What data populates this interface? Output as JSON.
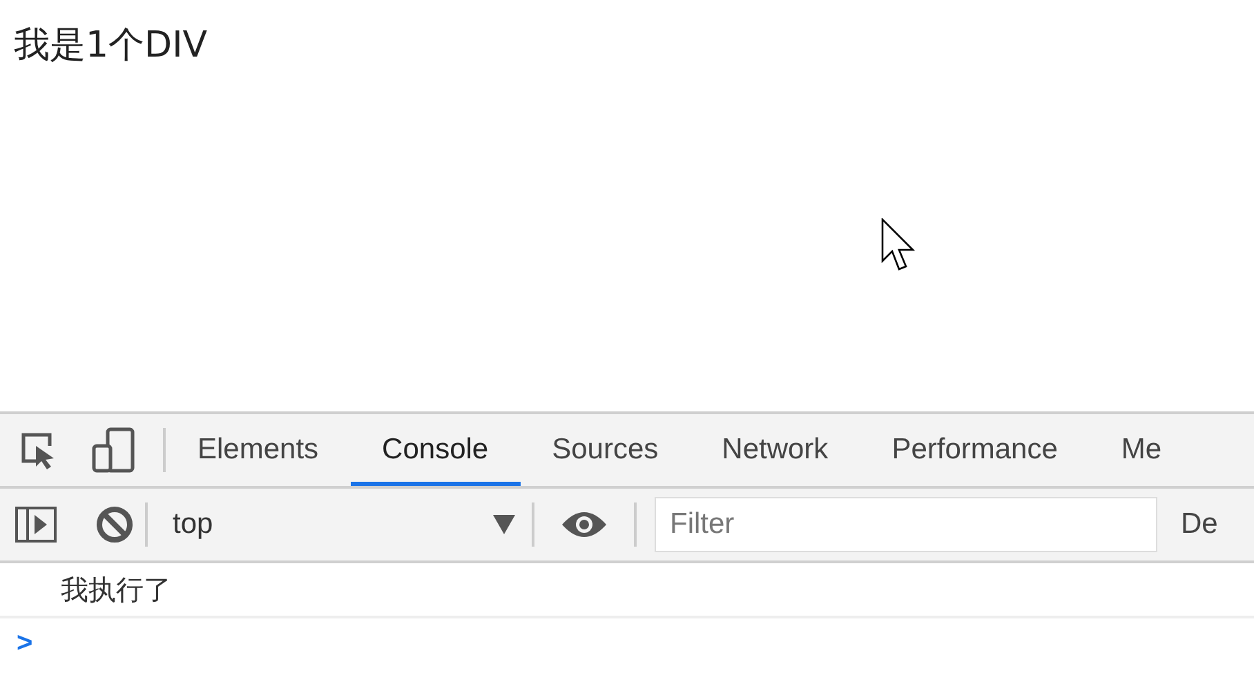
{
  "page": {
    "heading": "我是1个DIV"
  },
  "devtools": {
    "tabs": [
      {
        "label": "Elements",
        "selected": false
      },
      {
        "label": "Console",
        "selected": true
      },
      {
        "label": "Sources",
        "selected": false
      },
      {
        "label": "Network",
        "selected": false
      },
      {
        "label": "Performance",
        "selected": false
      },
      {
        "label": "Me",
        "selected": false
      }
    ],
    "context": {
      "value": "top"
    },
    "filter": {
      "placeholder": "Filter"
    },
    "levels_label": "De",
    "messages": [
      "我执行了"
    ],
    "prompt": ">"
  }
}
